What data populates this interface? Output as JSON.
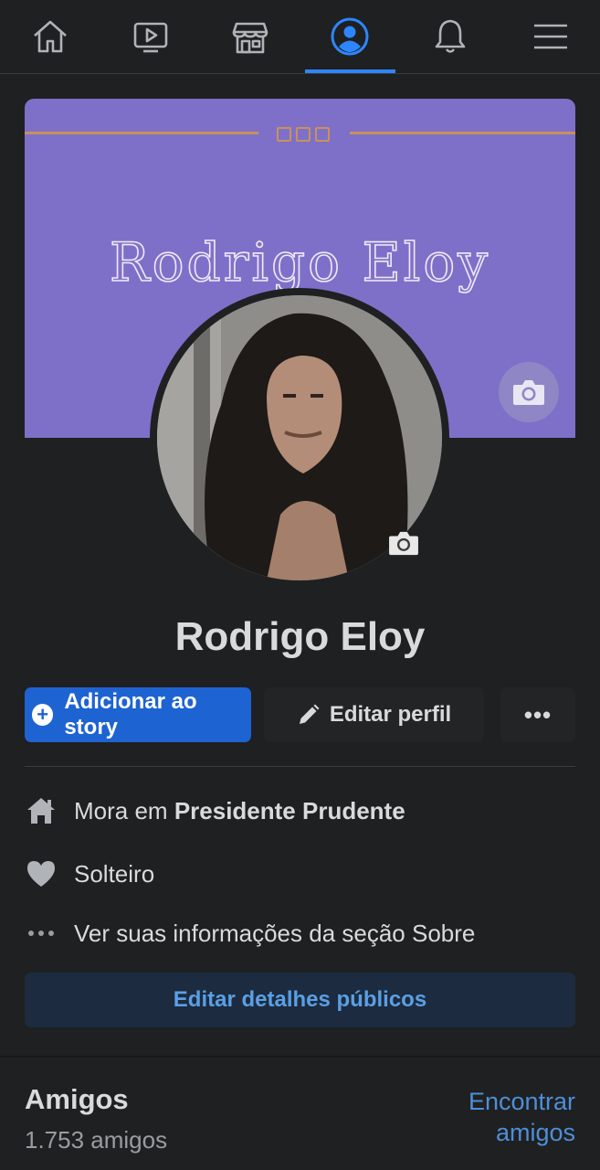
{
  "nav": {
    "items": [
      {
        "name": "home-icon"
      },
      {
        "name": "watch-icon"
      },
      {
        "name": "marketplace-icon"
      },
      {
        "name": "profile-icon",
        "active": true
      },
      {
        "name": "notifications-icon"
      },
      {
        "name": "menu-icon"
      }
    ],
    "accent": "#2d86ff"
  },
  "cover": {
    "title": "Rodrigo Eloy",
    "background": "#7e70c9"
  },
  "profile": {
    "name": "Rodrigo Eloy"
  },
  "actions": {
    "story_label": "Adicionar ao story",
    "edit_label": "Editar perfil",
    "more_label": "•••"
  },
  "details": {
    "lives_prefix": "Mora em ",
    "lives_city": "Presidente Prudente",
    "relationship": "Solteiro",
    "about": "Ver suas informações da seção Sobre",
    "edit_public_label": "Editar detalhes públicos"
  },
  "friends": {
    "title": "Amigos",
    "count": "1.753 amigos",
    "find_line1": "Encontrar",
    "find_line2": "amigos"
  }
}
